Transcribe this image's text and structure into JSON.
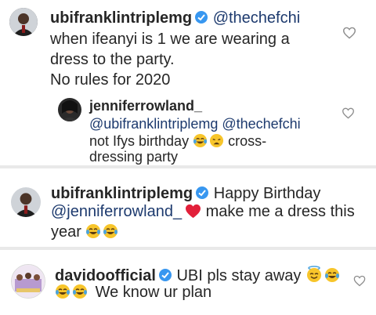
{
  "comment1": {
    "username": "ubifranklintriplemg",
    "mention": "@thechefchi",
    "line1": "when ifeanyi is 1 we are wearing a",
    "line2": "dress to the party.",
    "line3": "No rules for 2020",
    "heart_icon": "heart-outline-icon"
  },
  "reply1": {
    "username": "jenniferrowland_",
    "line1": "@ubifranklintriplemg @thechefchi",
    "line2_text": "not Ifys birthday",
    "line2_tail": "cross-",
    "line3": "dressing party",
    "emojis": [
      "tears-of-joy-emoji",
      "weary-face-emoji"
    ],
    "heart_icon": "heart-outline-icon"
  },
  "comment2": {
    "username": "ubifranklintriplemg",
    "text_a": "Happy Birthday",
    "mention": "@jenniferrowland_",
    "text_b": "make me a dress this",
    "line3": "year",
    "emojis": [
      "red-heart-emoji",
      "tears-of-joy-emoji",
      "tears-of-joy-emoji"
    ]
  },
  "comment3": {
    "username": "davidoofficial",
    "text_a": "UBI pls stay away",
    "line2": "We know ur plan",
    "emojis": [
      "smiling-halo-emoji",
      "tears-of-joy-emoji",
      "tears-of-joy-emoji",
      "tears-of-joy-emoji"
    ],
    "heart_icon": "heart-outline-icon"
  },
  "colors": {
    "text": "#262626",
    "mention": "#1d3a6e",
    "verified": "#3897f0",
    "separator": "#e9e9e9",
    "heart_stroke": "#8e8e8e"
  }
}
